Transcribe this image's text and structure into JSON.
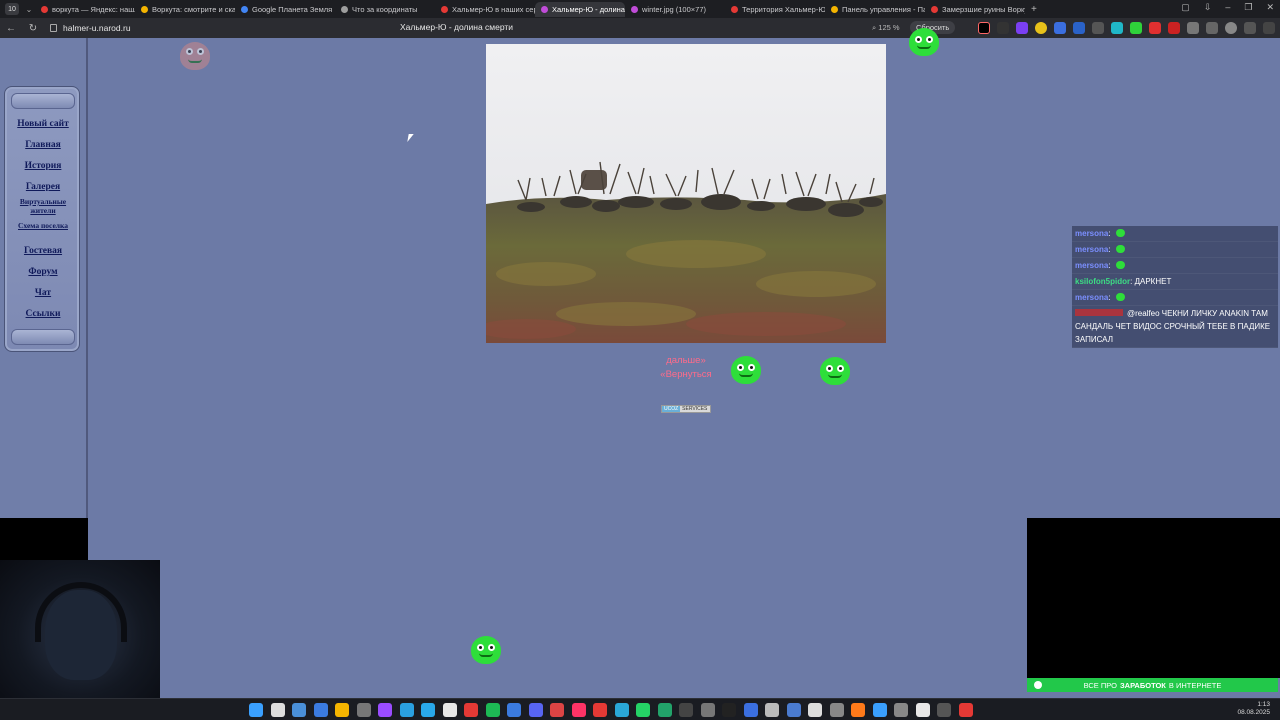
{
  "browser": {
    "tab_count": "10",
    "tabs": [
      {
        "label": "воркута — Яндекс: нашл",
        "favicon_color": "#e53935"
      },
      {
        "label": "Воркута: смотрите и ска",
        "favicon_color": "#f4b400"
      },
      {
        "label": "Google Планета Земля",
        "favicon_color": "#4285f4"
      },
      {
        "label": "Что за координаты",
        "favicon_color": "#9e9e9e"
      },
      {
        "label": "Хальмер-Ю в наших серд",
        "favicon_color": "#e53935"
      },
      {
        "label": "Хальмер-Ю - долина с",
        "favicon_color": "#c04cd8",
        "active": true
      },
      {
        "label": "winter.jpg (100×77)",
        "favicon_color": "#c04cd8"
      },
      {
        "label": "Территория Хальмер-Ю",
        "favicon_color": "#e53935"
      },
      {
        "label": "Панель управления - Пан",
        "favicon_color": "#f4b400"
      },
      {
        "label": "Замерзшие руины Ворку",
        "favicon_color": "#e53935"
      }
    ],
    "url": "halmer-u.narod.ru",
    "page_title": "Хальмер-Ю - долина смерти",
    "zoom": "125 %",
    "pill_label": "Сбросить"
  },
  "site": {
    "menu": [
      {
        "label": "Новый сайт"
      },
      {
        "label": "Главная"
      },
      {
        "label": "История"
      },
      {
        "label": "Галерея"
      },
      {
        "label": "Виртуальные жители",
        "small": true
      },
      {
        "label": "Схема поселка",
        "small": true
      },
      {
        "label": "Гостевая"
      },
      {
        "label": "Форум"
      },
      {
        "label": "Чат"
      },
      {
        "label": "Ссылки"
      }
    ],
    "nav_next": "дальше»",
    "nav_back": "«Вернуться",
    "counter_left": "UCOZ",
    "counter_right": "SERVICES"
  },
  "chat": [
    {
      "user": "mersona",
      "user_color": "#7b8fff",
      "emote": true,
      "text": ""
    },
    {
      "user": "mersona",
      "user_color": "#7b8fff",
      "emote": true,
      "text": ""
    },
    {
      "user": "mersona",
      "user_color": "#7b8fff",
      "emote": true,
      "text": ""
    },
    {
      "user": "ksilofon5pidor",
      "user_color": "#3ddc84",
      "emote": false,
      "text": "ДАРКНЕТ"
    },
    {
      "user": "mersona",
      "user_color": "#7b8fff",
      "emote": true,
      "text": ""
    },
    {
      "user": "",
      "user_color": "#d42a2a",
      "emote": false,
      "text": "@realfeo ЧЕКНИ ЛИЧКУ ANAKIN ТАМ САНДАЛЬ ЧЕТ ВИДОС СРОЧНЫЙ ТЕБЕ В ПАДИКЕ ЗАПИСАЛ"
    }
  ],
  "stream": {
    "promo_pre": "ВСЕ ПРО",
    "promo_bold": "ЗАРАБОТОК",
    "promo_post": "В ИНТЕРНЕТЕ"
  },
  "taskbar": {
    "time": "1:13",
    "date": "08.08.2025"
  },
  "colors": {
    "page_bg": "#6c7aa6",
    "link_pink": "#ff6b8a",
    "emote_green": "#2ede3a",
    "promo_green": "#22c84a"
  }
}
